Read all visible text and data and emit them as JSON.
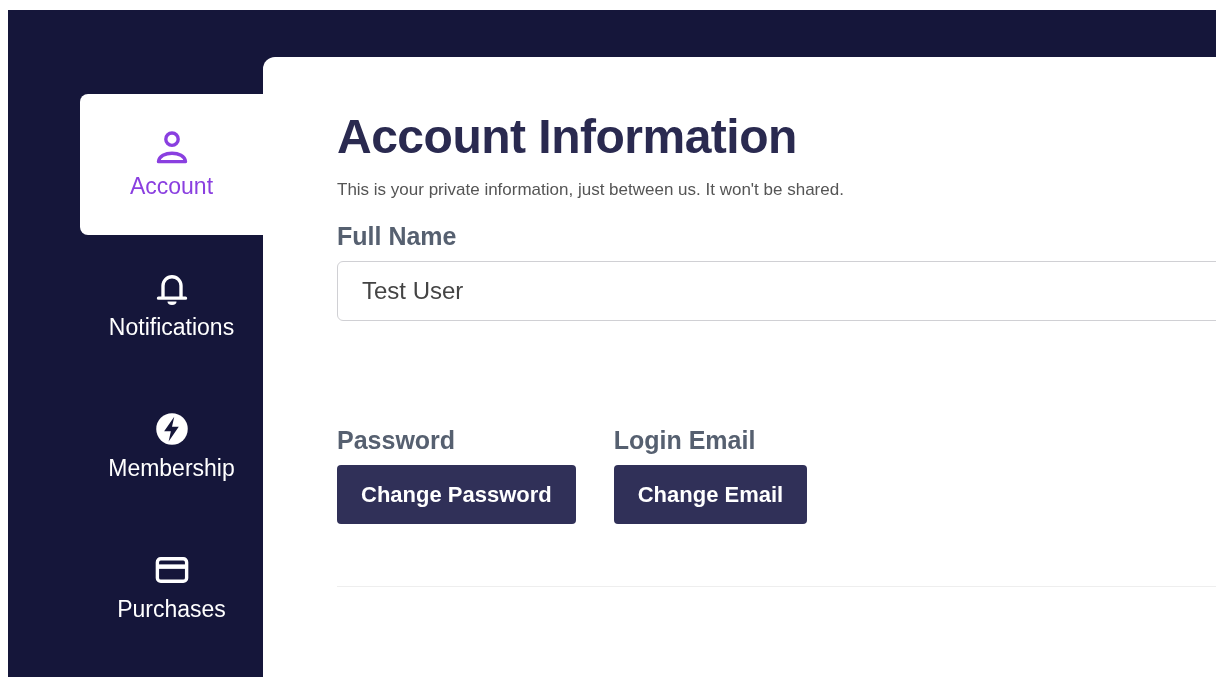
{
  "sidebar": {
    "items": [
      {
        "label": "Account",
        "selected": true
      },
      {
        "label": "Notifications",
        "selected": false
      },
      {
        "label": "Membership",
        "selected": false
      },
      {
        "label": "Purchases",
        "selected": false
      }
    ]
  },
  "content": {
    "title": "Account Information",
    "subtitle": "This is your private information, just between us. It won't be shared.",
    "full_name": {
      "label": "Full Name",
      "value": "Test User"
    },
    "actions": [
      {
        "label": "Password",
        "button": "Change Password"
      },
      {
        "label": "Login Email",
        "button": "Change Email"
      }
    ]
  }
}
